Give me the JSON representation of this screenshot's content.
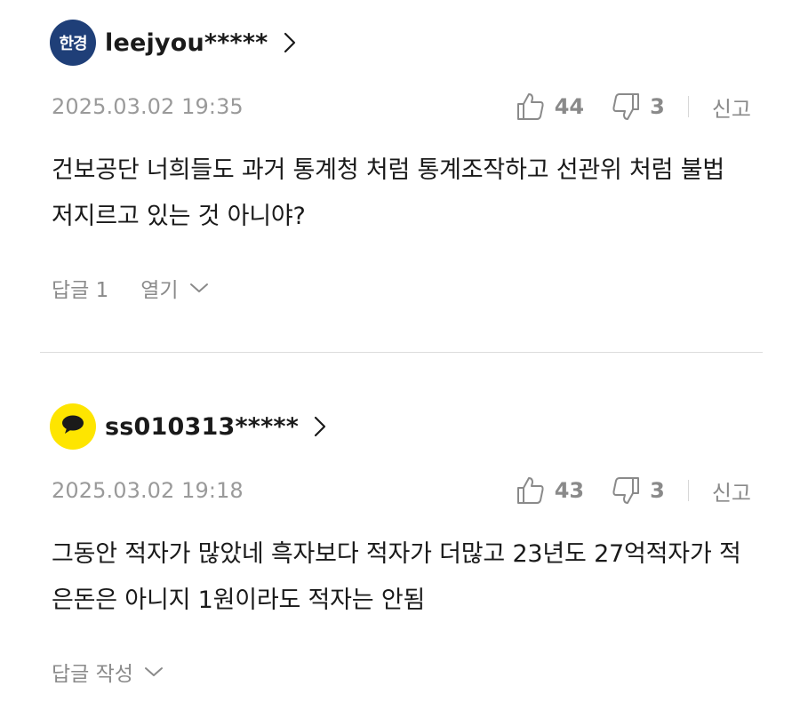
{
  "comments": [
    {
      "avatar_text": "한경",
      "avatar_color": "#1f3f78",
      "author": "leejyou*****",
      "date": "2025.03.02 19:35",
      "likes": "44",
      "dislikes": "3",
      "report_label": "신고",
      "text": "건보공단 너희들도 과거 통계청 처럼 통계조작하고 선관위 처럼 불법 저지르고 있는 것 아니야?",
      "reply_label": "답글 1",
      "open_label": "열기"
    },
    {
      "avatar_icon": "kakao-talk-icon",
      "avatar_color": "#fee500",
      "author": "ss010313*****",
      "date": "2025.03.02 19:18",
      "likes": "43",
      "dislikes": "3",
      "report_label": "신고",
      "text": "그동안 적자가 많았네 흑자보다 적자가 더많고 23년도 27억적자가 적은돈은 아니지 1원이라도 적자는 안됨",
      "write_reply_label": "답글 작성"
    }
  ]
}
